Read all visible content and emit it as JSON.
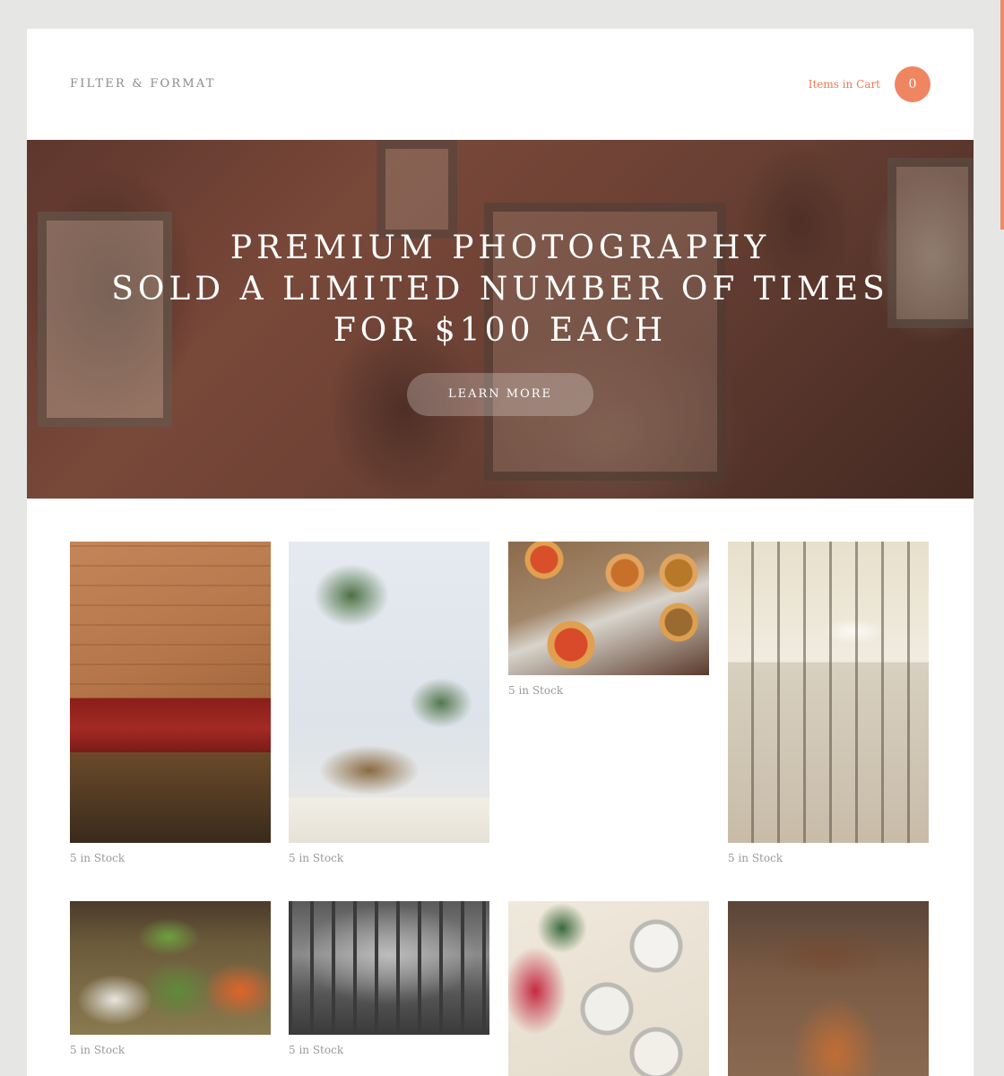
{
  "header": {
    "logo": "FILTER & FORMAT",
    "cart_label": "Items in Cart",
    "cart_count": "0"
  },
  "hero": {
    "lines": [
      "PREMIUM PHOTOGRAPHY",
      "SOLD A LIMITED NUMBER OF TIMES",
      "FOR $100 EACH"
    ],
    "button_label": "LEARN MORE"
  },
  "products": [
    {
      "stock": "5 in Stock",
      "image": "restaurant-booth"
    },
    {
      "stock": "5 in Stock",
      "image": "palm-trees-beach"
    },
    {
      "stock": "5 in Stock",
      "image": "pizza-tarts"
    },
    {
      "stock": "5 in Stock",
      "image": "dog-on-stairs"
    },
    {
      "stock": "5 in Stock",
      "image": "vegetable-market"
    },
    {
      "stock": "5 in Stock",
      "image": "forest-bw"
    },
    {
      "stock": "",
      "image": "ice-cream-cups"
    },
    {
      "stock": "",
      "image": "drink-glass"
    }
  ],
  "colors": {
    "accent": "#f08561",
    "page_background": "#e6e6e4",
    "card_background": "#ffffff",
    "muted_text": "#9a9a9a"
  }
}
